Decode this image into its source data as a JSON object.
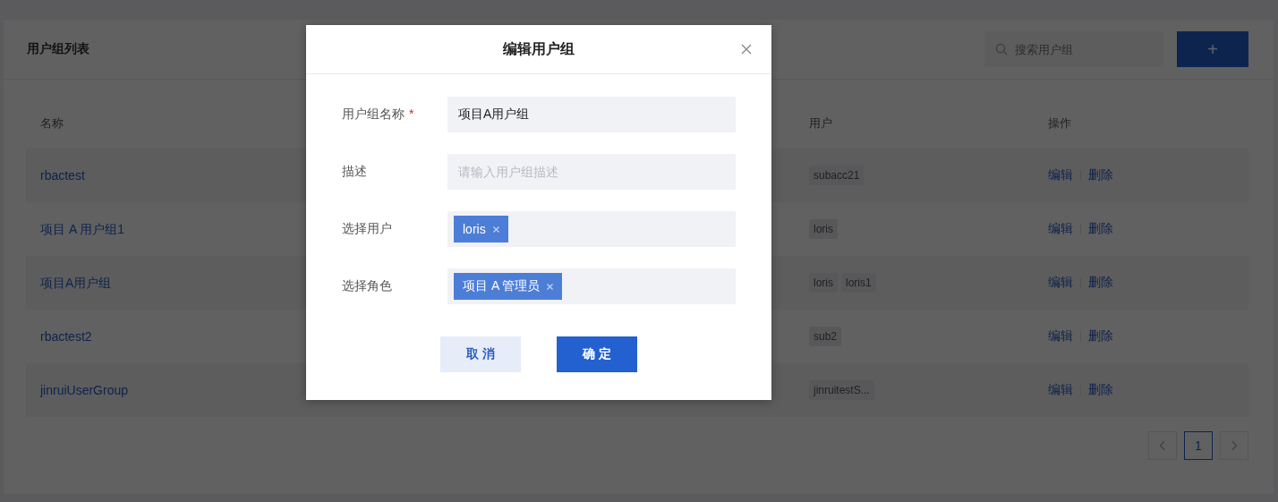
{
  "page": {
    "title": "用户组列表",
    "search": {
      "placeholder": "搜索用户组"
    },
    "add_button": "+"
  },
  "table": {
    "columns": [
      "名称",
      "用户",
      "操作"
    ],
    "rows": [
      {
        "name": "rbactest",
        "users": [
          "subacc21"
        ],
        "actions": [
          "编辑",
          "删除"
        ]
      },
      {
        "name": "项目 A 用户组1",
        "users": [
          "loris"
        ],
        "actions": [
          "编辑",
          "删除"
        ]
      },
      {
        "name": "项目A用户组",
        "users": [
          "loris",
          "loris1"
        ],
        "actions": [
          "编辑",
          "删除"
        ]
      },
      {
        "name": "rbactest2",
        "users": [
          "sub2"
        ],
        "actions": [
          "编辑",
          "删除"
        ]
      },
      {
        "name": "jinruiUserGroup",
        "users": [
          "jinruitestS..."
        ],
        "actions": [
          "编辑",
          "删除"
        ]
      }
    ]
  },
  "pagination": {
    "pages": [
      {
        "label": "1",
        "selected": true
      }
    ]
  },
  "dialog": {
    "title": "编辑用户组",
    "fields": [
      {
        "kind": "text",
        "label": "用户组名称",
        "required_mark": "*",
        "value": "项目A用户组"
      },
      {
        "kind": "text",
        "label": "描述",
        "placeholder": "请输入用户组描述"
      },
      {
        "kind": "tags",
        "label": "选择用户",
        "tags": [
          "loris"
        ]
      },
      {
        "kind": "tags",
        "label": "选择角色",
        "tags": [
          "项目 A 管理员"
        ]
      }
    ],
    "buttons": [
      {
        "label": "取 消",
        "kind": "secondary"
      },
      {
        "label": "确 定",
        "kind": "primary"
      }
    ]
  }
}
